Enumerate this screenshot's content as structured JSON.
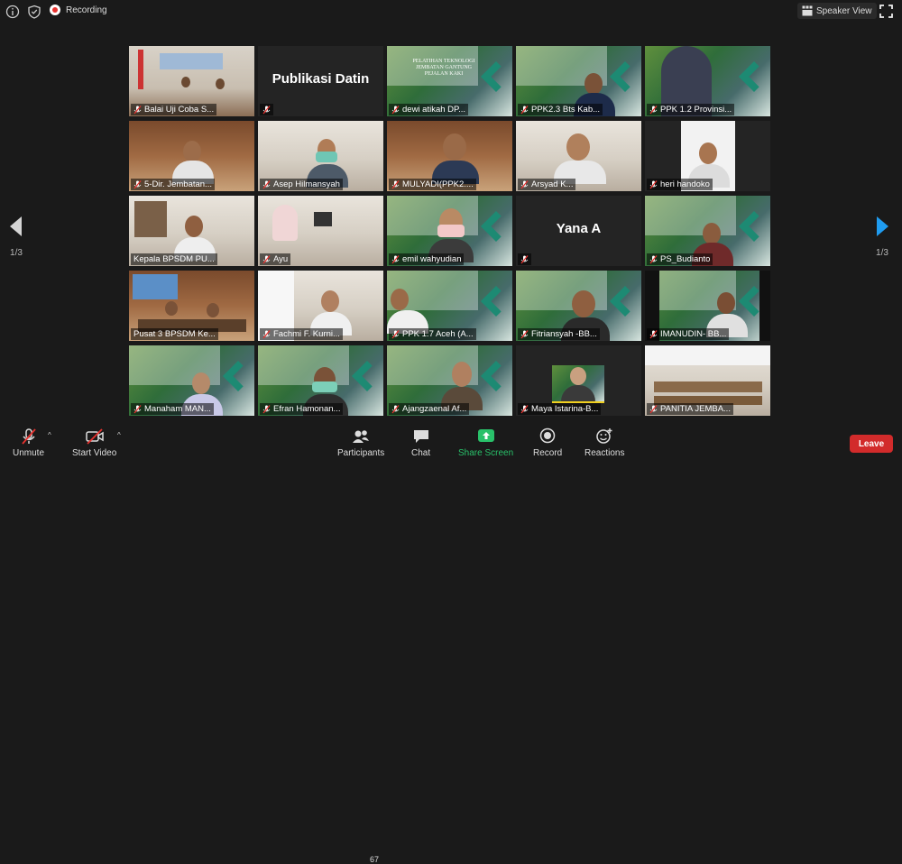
{
  "topbar": {
    "recording_label": "Recording",
    "speaker_view_label": "Speaker View"
  },
  "pagination": {
    "left_count": "1/3",
    "right_count": "1/3"
  },
  "tiles": [
    {
      "name": "Balai Uji Coba S..."
    },
    {
      "name": "",
      "big": "Publikasi Datin"
    },
    {
      "name": "dewi atikah DP..."
    },
    {
      "name": "PPK2.3 Bts Kab..."
    },
    {
      "name": "PPK 1.2 Provinsi..."
    },
    {
      "name": "5-Dir. Jembatan..."
    },
    {
      "name": "Asep Hilmansyah"
    },
    {
      "name": "MULYADI(PPK2...."
    },
    {
      "name": "Arsyad K..."
    },
    {
      "name": "heri handoko"
    },
    {
      "name": "Kepala BPSDM PU..."
    },
    {
      "name": "Ayu"
    },
    {
      "name": "emil wahyudian"
    },
    {
      "name": "",
      "big": "Yana A"
    },
    {
      "name": "PS_Budianto"
    },
    {
      "name": "Pusat 3 BPSDM Ke..."
    },
    {
      "name": "Fachmi F. Kurni..."
    },
    {
      "name": "PPK 1.7 Aceh (A..."
    },
    {
      "name": "Fitriansyah -BB..."
    },
    {
      "name": "IMANUDIN- BB..."
    },
    {
      "name": "Manaham MAN..."
    },
    {
      "name": "Efran Hamonan..."
    },
    {
      "name": "Ajangzaenal Af..."
    },
    {
      "name": "Maya Istarina-B..."
    },
    {
      "name": "PANITIA JEMBA..."
    }
  ],
  "slide": {
    "line1": "PELATIHAN TEKNOLOGI",
    "line2": "JEMBATAN GANTUNG",
    "line3": "PEJALAN KAKI"
  },
  "toolbar": {
    "unmute_label": "Unmute",
    "start_video_label": "Start Video",
    "participants_label": "Participants",
    "participants_count": "67",
    "chat_label": "Chat",
    "share_label": "Share Screen",
    "record_label": "Record",
    "reactions_label": "Reactions",
    "leave_label": "Leave"
  },
  "colors": {
    "active_speaker": "#c7e23a",
    "share_green": "#29c16a",
    "leave_red": "#d22b2b"
  }
}
